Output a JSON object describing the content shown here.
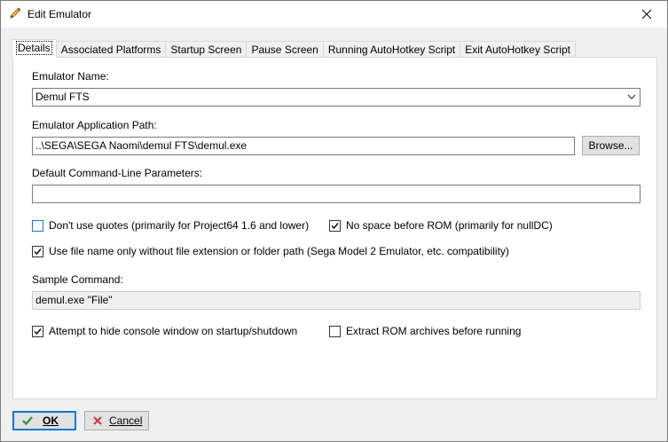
{
  "window": {
    "title": "Edit Emulator",
    "title_icon": "pencil-icon",
    "close_icon": "close-icon"
  },
  "tabs": [
    {
      "label": "Details",
      "active": true
    },
    {
      "label": "Associated Platforms",
      "active": false
    },
    {
      "label": "Startup Screen",
      "active": false
    },
    {
      "label": "Pause Screen",
      "active": false
    },
    {
      "label": "Running AutoHotkey Script",
      "active": false
    },
    {
      "label": "Exit AutoHotkey Script",
      "active": false
    }
  ],
  "details": {
    "emulator_name_label": "Emulator Name:",
    "emulator_name_value": "Demul FTS",
    "app_path_label": "Emulator Application Path:",
    "app_path_value": "..\\SEGA\\SEGA Naomi\\demul FTS\\demul.exe",
    "browse_label": "Browse...",
    "cmd_params_label": "Default Command-Line Parameters:",
    "cmd_params_value": "",
    "dont_use_quotes": {
      "label": "Don't use quotes (primarily for Project64 1.6 and lower)",
      "checked": false
    },
    "no_space_before_rom": {
      "label": "No space before ROM (primarily for nullDC)",
      "checked": true
    },
    "file_name_only": {
      "label": "Use file name only without file extension or folder path (Sega Model 2 Emulator, etc. compatibility)",
      "checked": true
    },
    "sample_command_label": "Sample Command:",
    "sample_command_value": "demul.exe \"File\"",
    "hide_console": {
      "label": "Attempt to hide console window on startup/shutdown",
      "checked": true
    },
    "extract_rom": {
      "label": "Extract ROM archives before running",
      "checked": false
    }
  },
  "footer": {
    "ok_label": "OK",
    "cancel_label": "Cancel",
    "ok_icon": "checkmark-icon",
    "cancel_icon": "cancel-x-icon"
  },
  "colors": {
    "accent": "#0078d7",
    "ok_check": "#2e9e3a",
    "cancel_x": "#d13438"
  }
}
